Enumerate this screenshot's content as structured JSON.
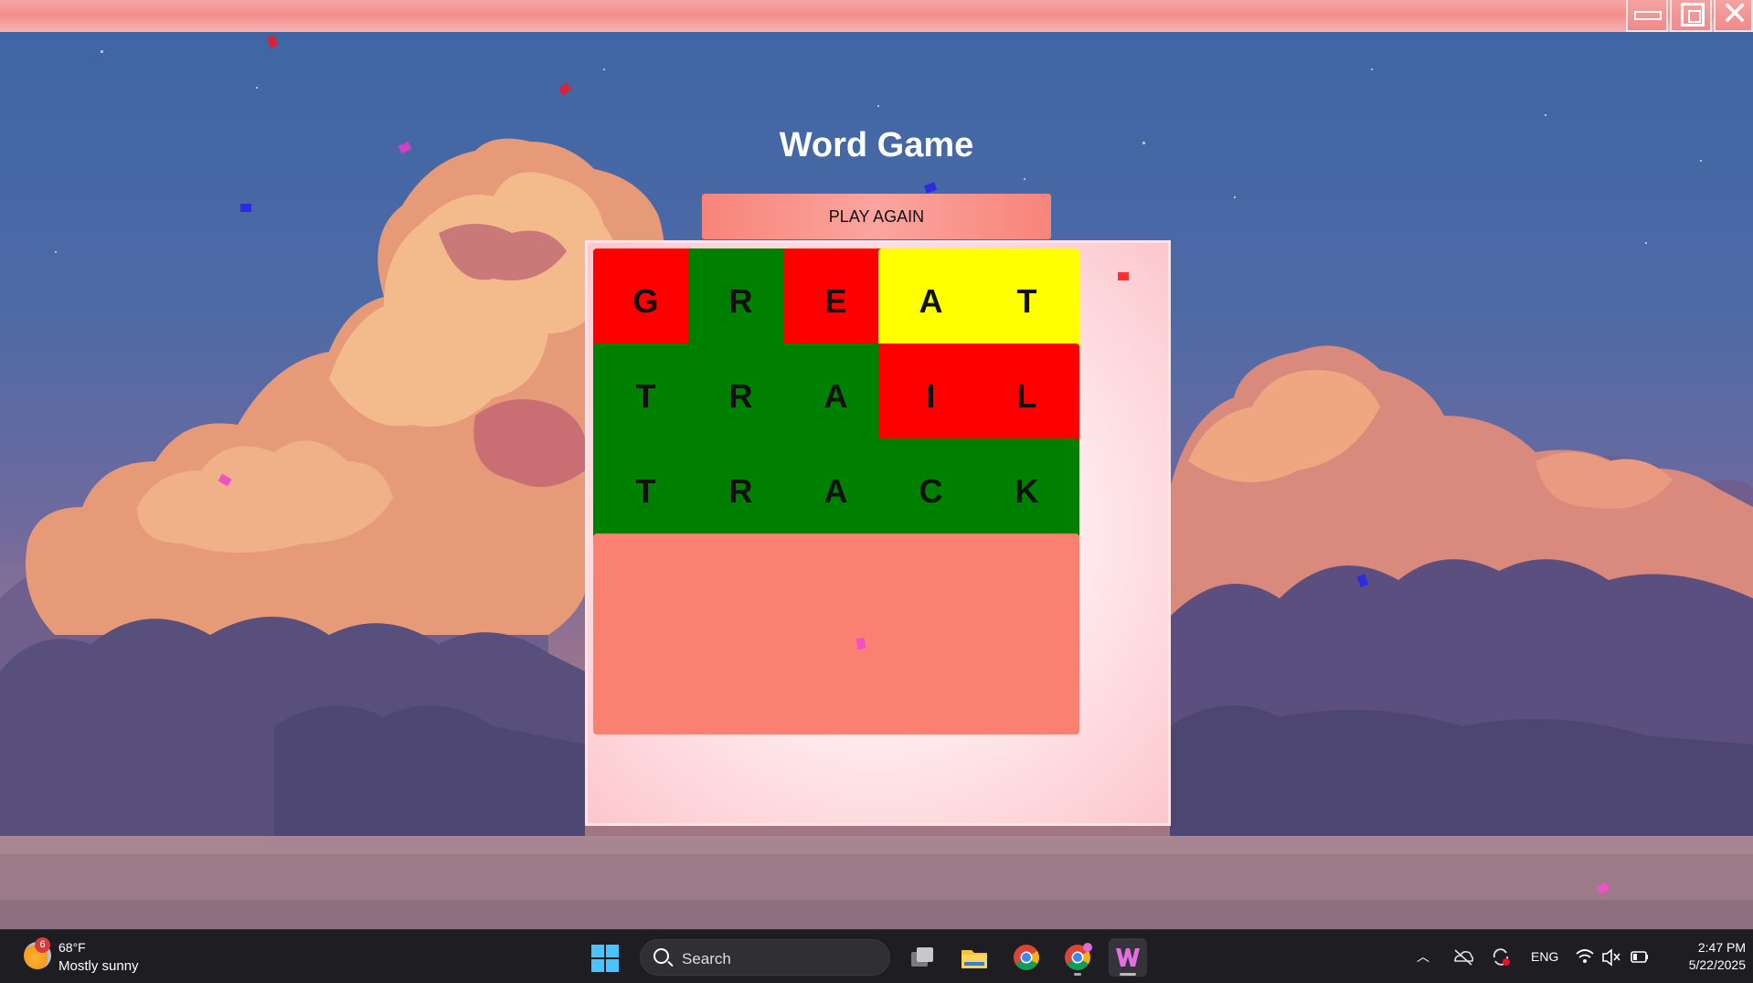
{
  "window": {
    "icons": [
      "minimize-icon",
      "maximize-icon",
      "close-icon"
    ]
  },
  "game": {
    "title": "Word Game",
    "play_again_label": "PLAY AGAIN",
    "colors": {
      "correct": "#008000",
      "present": "#ffff00",
      "absent": "#ff0000",
      "empty": "#fa8072"
    },
    "rows": [
      [
        {
          "letter": "G",
          "state": "absent"
        },
        {
          "letter": "R",
          "state": "correct"
        },
        {
          "letter": "E",
          "state": "absent"
        },
        {
          "letter": "A",
          "state": "present"
        },
        {
          "letter": "T",
          "state": "present"
        }
      ],
      [
        {
          "letter": "T",
          "state": "correct"
        },
        {
          "letter": "R",
          "state": "correct"
        },
        {
          "letter": "A",
          "state": "correct"
        },
        {
          "letter": "I",
          "state": "absent"
        },
        {
          "letter": "L",
          "state": "absent"
        }
      ],
      [
        {
          "letter": "T",
          "state": "correct"
        },
        {
          "letter": "R",
          "state": "correct"
        },
        {
          "letter": "A",
          "state": "correct"
        },
        {
          "letter": "C",
          "state": "correct"
        },
        {
          "letter": "K",
          "state": "correct"
        }
      ],
      [
        {
          "letter": "",
          "state": "empty"
        },
        {
          "letter": "",
          "state": "empty"
        },
        {
          "letter": "",
          "state": "empty"
        },
        {
          "letter": "",
          "state": "empty"
        },
        {
          "letter": "",
          "state": "empty"
        }
      ],
      [
        {
          "letter": "",
          "state": "empty"
        },
        {
          "letter": "",
          "state": "empty"
        },
        {
          "letter": "",
          "state": "empty"
        },
        {
          "letter": "",
          "state": "empty"
        },
        {
          "letter": "",
          "state": "empty"
        }
      ]
    ]
  },
  "taskbar": {
    "weather": {
      "badge": "6",
      "temp": "68°F",
      "desc": "Mostly sunny"
    },
    "search_label": "Search",
    "apps": [
      "task-view-icon",
      "file-explorer-icon",
      "chrome-icon",
      "chrome-profile-icon",
      "word-game-app-icon"
    ],
    "tray": {
      "language": "ENG",
      "time": "2:47 PM",
      "date": "5/22/2025",
      "icons": [
        "chevron-up-icon",
        "onedrive-offline-icon",
        "sync-icon",
        "wifi-icon",
        "volume-muted-icon",
        "battery-icon"
      ]
    }
  }
}
